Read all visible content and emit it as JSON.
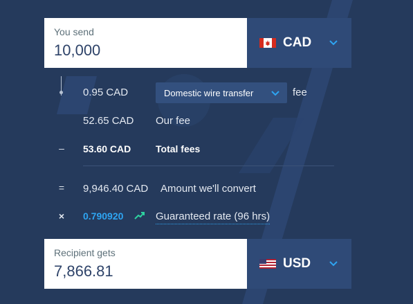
{
  "send": {
    "label": "You send",
    "value": "10,000",
    "currency": "CAD",
    "flag_icon": "canada-flag-icon"
  },
  "fees": {
    "transfer_fee": "0.95 CAD",
    "method": "Domestic wire transfer",
    "method_suffix": "fee",
    "our_fee": "52.65 CAD",
    "our_fee_label": "Our fee",
    "total": "53.60 CAD",
    "total_label": "Total fees"
  },
  "conversion": {
    "amount": "9,946.40 CAD",
    "amount_label": "Amount we'll convert",
    "rate": "0.790920",
    "rate_label": "Guaranteed rate (96 hrs)"
  },
  "operators": {
    "minus": "–",
    "equals": "=",
    "times": "×"
  },
  "receive": {
    "label": "Recipient gets",
    "value": "7,866.81",
    "currency": "USD",
    "flag_icon": "us-flag-icon"
  },
  "colors": {
    "background": "#253a5c",
    "accent": "#2ea5f2",
    "trend": "#2ed3a0"
  }
}
